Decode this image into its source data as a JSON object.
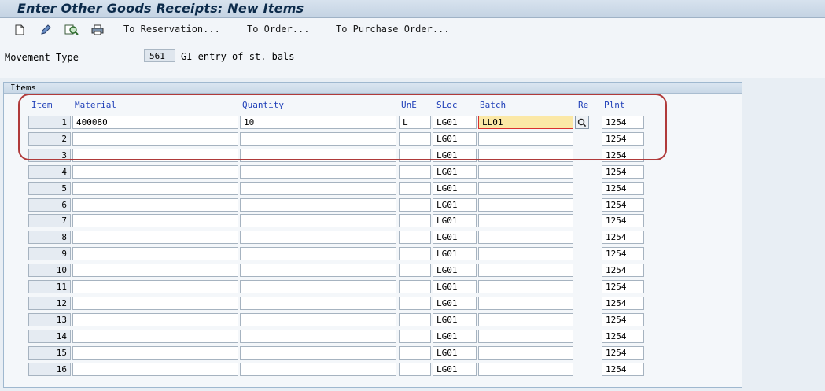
{
  "window": {
    "title": "Enter Other Goods Receipts: New Items"
  },
  "toolbar": {
    "icons": [
      "new-document-icon",
      "edit-pencil-icon",
      "display-magnifier-icon",
      "print-icon"
    ],
    "to_reservation": "To Reservation...",
    "to_order": "To Order...",
    "to_purchase_order": "To Purchase Order..."
  },
  "header": {
    "movement_type_label": "Movement Type",
    "movement_type_code": "561",
    "movement_type_desc": "GI entry of st. bals"
  },
  "items": {
    "group_title": "Items",
    "columns": {
      "item": "Item",
      "material": "Material",
      "quantity": "Quantity",
      "une": "UnE",
      "sloc": "SLoc",
      "batch": "Batch",
      "re": "Re",
      "plnt": "Plnt"
    },
    "rows": [
      {
        "item": "1",
        "material": "400080",
        "quantity": "10",
        "une": "L",
        "sloc": "LG01",
        "batch": "LL01",
        "plnt": "1254"
      },
      {
        "item": "2",
        "material": "",
        "quantity": "",
        "une": "",
        "sloc": "LG01",
        "batch": "",
        "plnt": "1254"
      },
      {
        "item": "3",
        "material": "",
        "quantity": "",
        "une": "",
        "sloc": "LG01",
        "batch": "",
        "plnt": "1254"
      },
      {
        "item": "4",
        "material": "",
        "quantity": "",
        "une": "",
        "sloc": "LG01",
        "batch": "",
        "plnt": "1254"
      },
      {
        "item": "5",
        "material": "",
        "quantity": "",
        "une": "",
        "sloc": "LG01",
        "batch": "",
        "plnt": "1254"
      },
      {
        "item": "6",
        "material": "",
        "quantity": "",
        "une": "",
        "sloc": "LG01",
        "batch": "",
        "plnt": "1254"
      },
      {
        "item": "7",
        "material": "",
        "quantity": "",
        "une": "",
        "sloc": "LG01",
        "batch": "",
        "plnt": "1254"
      },
      {
        "item": "8",
        "material": "",
        "quantity": "",
        "une": "",
        "sloc": "LG01",
        "batch": "",
        "plnt": "1254"
      },
      {
        "item": "9",
        "material": "",
        "quantity": "",
        "une": "",
        "sloc": "LG01",
        "batch": "",
        "plnt": "1254"
      },
      {
        "item": "10",
        "material": "",
        "quantity": "",
        "une": "",
        "sloc": "LG01",
        "batch": "",
        "plnt": "1254"
      },
      {
        "item": "11",
        "material": "",
        "quantity": "",
        "une": "",
        "sloc": "LG01",
        "batch": "",
        "plnt": "1254"
      },
      {
        "item": "12",
        "material": "",
        "quantity": "",
        "une": "",
        "sloc": "LG01",
        "batch": "",
        "plnt": "1254"
      },
      {
        "item": "13",
        "material": "",
        "quantity": "",
        "une": "",
        "sloc": "LG01",
        "batch": "",
        "plnt": "1254"
      },
      {
        "item": "14",
        "material": "",
        "quantity": "",
        "une": "",
        "sloc": "LG01",
        "batch": "",
        "plnt": "1254"
      },
      {
        "item": "15",
        "material": "",
        "quantity": "",
        "une": "",
        "sloc": "LG01",
        "batch": "",
        "plnt": "1254"
      },
      {
        "item": "16",
        "material": "",
        "quantity": "",
        "une": "",
        "sloc": "LG01",
        "batch": "",
        "plnt": "1254"
      }
    ]
  }
}
